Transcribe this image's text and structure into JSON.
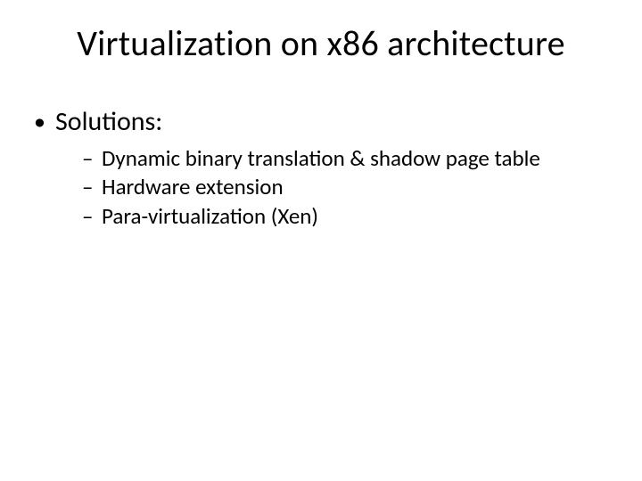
{
  "title": "Virtualization on x86 architecture",
  "bullets": {
    "level1_0": "Solutions:",
    "level2_0": "Dynamic binary translation & shadow page table",
    "level2_1": "Hardware extension",
    "level2_2": "Para-virtualization (Xen)"
  }
}
